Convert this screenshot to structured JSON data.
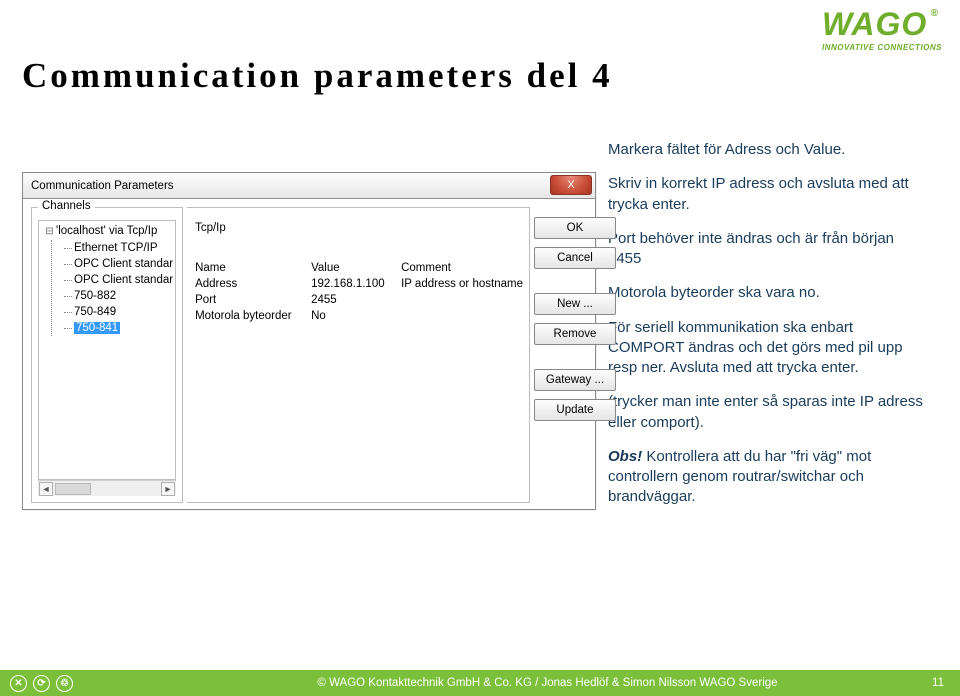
{
  "brand": {
    "name": "WAGO",
    "tag": "INNOVATIVE CONNECTIONS",
    "reg": "®"
  },
  "title": "Communication parameters del 4",
  "body": {
    "p1": "Markera fältet för Adress och Value.",
    "p2": "Skriv in korrekt IP adress och avsluta med att trycka enter.",
    "p3": "Port behöver inte ändras och är från början 2455",
    "p4": "Motorola byteorder ska vara no.",
    "p5": "För seriell kommunikation ska enbart COMPORT ändras och det görs med pil upp resp ner. Avsluta med att trycka enter.",
    "p6": "(trycker man inte enter så sparas inte IP adress eller comport).",
    "obs_label": "Obs!",
    "p7": " Kontrollera att du har \"fri väg\" mot controllern genom routrar/switchar och brandväggar."
  },
  "dialog": {
    "title": "Communication Parameters",
    "close_x": "X",
    "channels_legend": "Channels",
    "tree": {
      "root": "'localhost' via Tcp/Ip",
      "children": [
        "Ethernet TCP/IP",
        "OPC Client standar",
        "OPC Client standar",
        "750-882",
        "750-849",
        "750-841"
      ],
      "selected_index": 5
    },
    "params": {
      "heading_name": "Tcp/Ip",
      "cols": [
        "Name",
        "Value",
        "Comment"
      ],
      "rows": [
        {
          "name": "Address",
          "value": "192.168.1.100",
          "comment": "IP address or hostname"
        },
        {
          "name": "Port",
          "value": "2455",
          "comment": ""
        },
        {
          "name": "Motorola byteorder",
          "value": "No",
          "comment": ""
        }
      ]
    },
    "buttons": {
      "ok": "OK",
      "cancel": "Cancel",
      "new": "New ...",
      "remove": "Remove",
      "gateway": "Gateway ...",
      "update": "Update"
    }
  },
  "footer": {
    "copyright": "© WAGO Kontakttechnik GmbH & Co. KG",
    "sep": "  /  ",
    "authors": "Jonas Hedlöf & Simon Nilsson WAGO Sverige",
    "page": "11"
  }
}
